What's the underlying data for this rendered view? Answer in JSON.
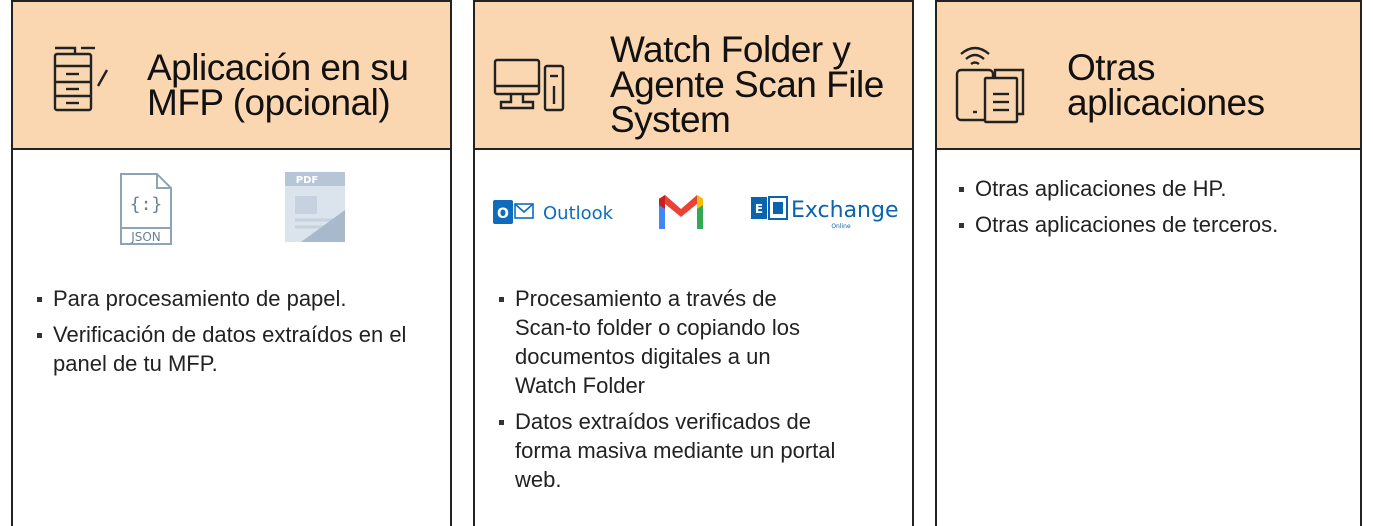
{
  "cards": [
    {
      "title_lines": [
        "Aplicación en su",
        "MFP (opcional)"
      ],
      "icon": "printer-mfp-icon",
      "logos": [
        "JSON",
        "PDF"
      ],
      "bullets": [
        "Para procesamiento de papel.",
        "Verificación de datos extraídos en el panel de tu MFP."
      ]
    },
    {
      "title_lines": [
        "Watch Folder y",
        "Agente Scan File",
        "System"
      ],
      "icon": "desktop-computer-icon",
      "logos": [
        "Outlook",
        "Exchange",
        "Online"
      ],
      "bullets": [
        "Procesamiento a través de Scan-to folder o copiando los documentos digitales a un Watch Folder",
        "Datos extraídos verificados de forma masiva mediante un portal web."
      ]
    },
    {
      "title_lines": [
        "Otras",
        "aplicaciones"
      ],
      "icon": "mobile-wireless-document-icon",
      "bullets": [
        "Otras aplicaciones de HP.",
        "Otras aplicaciones de terceros."
      ]
    }
  ],
  "colors": {
    "header_bg": "#fad7b0",
    "outlook_blue": "#0f6cbd",
    "exchange_blue": "#0a64ad"
  }
}
